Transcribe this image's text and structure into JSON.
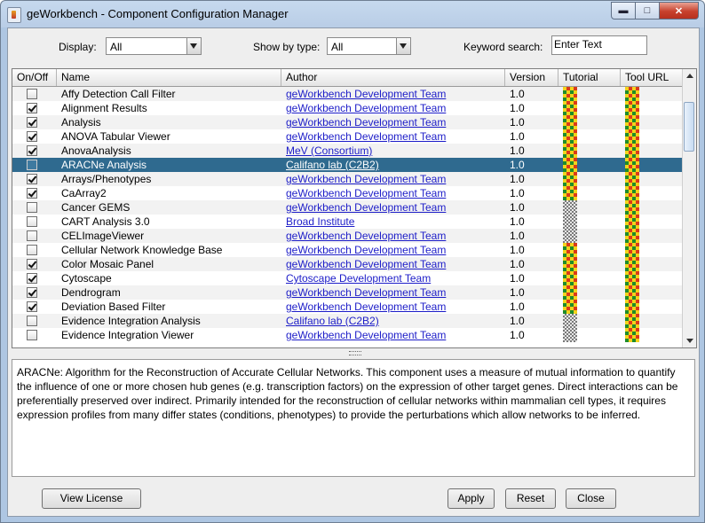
{
  "window": {
    "title": "geWorkbench - Component Configuration Manager"
  },
  "filters": {
    "display_label": "Display:",
    "display_value": "All",
    "type_label": "Show by type:",
    "type_value": "All",
    "keyword_label": "Keyword search:",
    "keyword_value": "Enter Text"
  },
  "table": {
    "columns": [
      "On/Off",
      "Name",
      "Author",
      "Version",
      "Tutorial",
      "Tool URL"
    ],
    "rows": [
      {
        "on": false,
        "name": "Affy Detection Call Filter",
        "author": "geWorkbench Development Team",
        "version": "1.0",
        "tutorial": "color",
        "url": "color"
      },
      {
        "on": true,
        "name": "Alignment Results",
        "author": "geWorkbench Development Team",
        "version": "1.0",
        "tutorial": "color",
        "url": "color"
      },
      {
        "on": true,
        "name": "Analysis",
        "author": "geWorkbench Development Team",
        "version": "1.0",
        "tutorial": "color",
        "url": "color"
      },
      {
        "on": true,
        "name": "ANOVA Tabular Viewer",
        "author": "geWorkbench Development Team",
        "version": "1.0",
        "tutorial": "color",
        "url": "color"
      },
      {
        "on": true,
        "name": "AnovaAnalysis",
        "author": "MeV (Consortium)",
        "version": "1.0",
        "tutorial": "color",
        "url": "color"
      },
      {
        "on": false,
        "name": "ARACNe Analysis",
        "author": "Califano lab (C2B2)",
        "version": "1.0",
        "tutorial": "color",
        "url": "color",
        "selected": true
      },
      {
        "on": true,
        "name": "Arrays/Phenotypes",
        "author": "geWorkbench Development Team",
        "version": "1.0",
        "tutorial": "color",
        "url": "color"
      },
      {
        "on": true,
        "name": "CaArray2",
        "author": "geWorkbench Development Team",
        "version": "1.0",
        "tutorial": "color",
        "url": "color"
      },
      {
        "on": false,
        "name": "Cancer GEMS",
        "author": "geWorkbench Development Team",
        "version": "1.0",
        "tutorial": "grey",
        "url": "color"
      },
      {
        "on": false,
        "name": "CART Analysis 3.0",
        "author": "Broad Institute",
        "version": "1.0",
        "tutorial": "grey",
        "url": "color"
      },
      {
        "on": false,
        "name": "CELImageViewer",
        "author": "geWorkbench Development Team",
        "version": "1.0",
        "tutorial": "grey",
        "url": "color"
      },
      {
        "on": false,
        "name": "Cellular Network Knowledge Base",
        "author": "geWorkbench Development Team",
        "version": "1.0",
        "tutorial": "color",
        "url": "color"
      },
      {
        "on": true,
        "name": "Color Mosaic Panel",
        "author": "geWorkbench Development Team",
        "version": "1.0",
        "tutorial": "color",
        "url": "color"
      },
      {
        "on": true,
        "name": "Cytoscape",
        "author": "Cytoscape Development Team",
        "version": "1.0",
        "tutorial": "color",
        "url": "color"
      },
      {
        "on": true,
        "name": "Dendrogram",
        "author": "geWorkbench Development Team",
        "version": "1.0",
        "tutorial": "color",
        "url": "color"
      },
      {
        "on": true,
        "name": "Deviation Based Filter",
        "author": "geWorkbench Development Team",
        "version": "1.0",
        "tutorial": "color",
        "url": "color"
      },
      {
        "on": false,
        "name": "Evidence Integration Analysis",
        "author": "Califano lab (C2B2)",
        "version": "1.0",
        "tutorial": "grey",
        "url": "color"
      },
      {
        "on": false,
        "name": "Evidence Integration Viewer",
        "author": "geWorkbench Development Team",
        "version": "1.0",
        "tutorial": "grey",
        "url": "color"
      }
    ]
  },
  "description": "ARACNe: Algorithm for the Reconstruction of Accurate Cellular Networks.  This component uses a measure of mutual information to quantify the influence of one or more chosen hub genes (e.g. transcription factors) on the expression of other target genes.  Direct interactions can be preferentially preserved over indirect.  Primarily intended for the reconstruction of cellular networks within mammalian cell types, it requires expression profiles from many differ states (conditions, phenotypes) to provide the perturbations which allow networks to be inferred.",
  "buttons": {
    "view_license": "View License",
    "apply": "Apply",
    "reset": "Reset",
    "close": "Close"
  }
}
